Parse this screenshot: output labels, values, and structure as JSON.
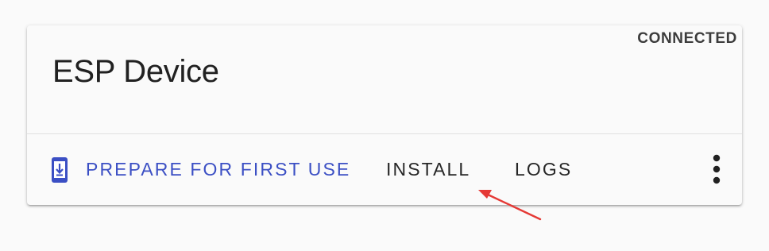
{
  "device": {
    "status": "CONNECTED",
    "title": "ESP Device"
  },
  "actions": {
    "prepare_label": "PREPARE FOR FIRST USE",
    "install_label": "INSTALL",
    "logs_label": "LOGS"
  },
  "icons": {
    "prepare": "phone-download-icon",
    "menu": "more-vertical-icon"
  },
  "colors": {
    "primary": "#3b4fc4",
    "annotation_arrow": "#e53935"
  }
}
